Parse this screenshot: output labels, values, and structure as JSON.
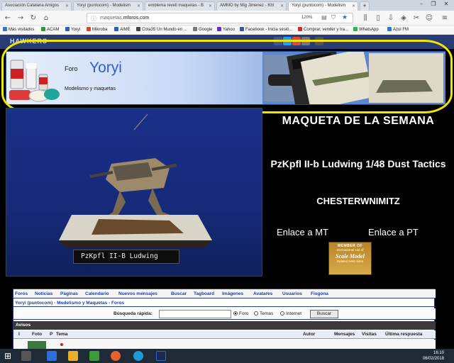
{
  "browser": {
    "tabs": [
      {
        "label": "Asociación Catalana Amigos",
        "active": false
      },
      {
        "label": "Yoryi (puntocom) - Modelism",
        "active": false
      },
      {
        "label": "emblema revell maquetas - B",
        "active": false
      },
      {
        "label": "AMMO by Mig Jimenez - Khl",
        "active": false
      },
      {
        "label": "Yoryi (puntocom) - Modelism",
        "active": true
      }
    ],
    "window_controls": [
      "–",
      "❐",
      "✕"
    ],
    "url_prefix": "maquetas.",
    "url_host": "mforos.com",
    "zoom": "120%",
    "bookmarks": [
      {
        "label": "Más visitados",
        "color": "#3c6fd0"
      },
      {
        "label": "ACAM",
        "color": "#2a9a3a"
      },
      {
        "label": "Yoryi",
        "color": "#2a5cc8"
      },
      {
        "label": "Mikroba",
        "color": "#d04a2a"
      },
      {
        "label": "AIME",
        "color": "#2a5cc8"
      },
      {
        "label": "Cota35 Un Mundo en ...",
        "color": "#444444"
      },
      {
        "label": "Google",
        "color": "#777777"
      },
      {
        "label": "Yahoo",
        "color": "#6a2ac8"
      },
      {
        "label": "Facebook - Inicia sesió...",
        "color": "#3b5998"
      },
      {
        "label": "Comprar, vender y tra...",
        "color": "#d02a2a"
      },
      {
        "label": "WhatsApp",
        "color": "#2ab54a"
      },
      {
        "label": "Azul FM",
        "color": "#2a7ad0"
      }
    ]
  },
  "site": {
    "hawkers_logo": "HAWKERS",
    "banner": {
      "foro_label": "Foro",
      "name": "Yoryi",
      "subtitle": "Modelismo y maquetas"
    },
    "photo_caption": "PzKpfl II-B Ludwing",
    "maqueta": {
      "heading": "MAQUETA DE LA SEMANA",
      "model": "PzKpfl II-b Ludwing 1/48 Dust Tactics",
      "author": "CHESTERWNIMITZ",
      "link_mt": "Enlace a MT",
      "link_pt": "Enlace a PT"
    },
    "badge": {
      "line1": "MEMBER OF",
      "line2": "International List of",
      "line3": "Scale Model",
      "line4": "Related Web Sites"
    }
  },
  "forum": {
    "nav_links": [
      "Foros",
      "Noticias",
      "Páginas",
      "Calendario",
      "Nuevos mensajes",
      "Buscar",
      "Tagboard",
      "Imágenes",
      "Avatares",
      "Usuarios",
      "Fisgona"
    ],
    "breadcrumb": [
      "Yoryi (puntocom)",
      "Modelismo y Maquetas",
      "Foros"
    ],
    "search_label": "Búsqueda rápida:",
    "search_value": "",
    "search_options": [
      {
        "label": "Foro",
        "checked": true
      },
      {
        "label": "Temas",
        "checked": false
      },
      {
        "label": "Internet",
        "checked": false
      }
    ],
    "search_button": "Buscar",
    "section_title": "Avisos",
    "columns": [
      "I",
      "Foto",
      "P",
      "Tema",
      "Autor",
      "Mensajes",
      "Visitas",
      "Última respuesta"
    ]
  },
  "taskbar": {
    "time": "16:10",
    "date": "06/02/2018"
  }
}
